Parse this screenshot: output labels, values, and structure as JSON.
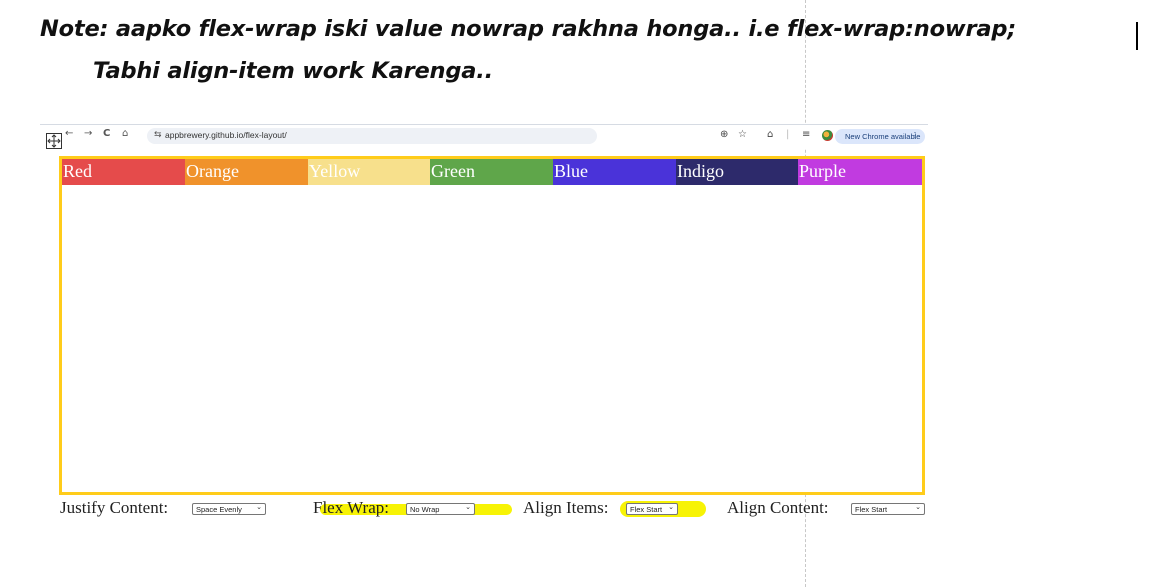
{
  "annotation": {
    "line1": "Note: aapko flex-wrap iski value nowrap rakhna honga..   i.e flex-wrap:nowrap;",
    "line2": "Tabhi align-item work Karenga.."
  },
  "browser": {
    "url": "appbrewery.github.io/flex-layout/",
    "update_pill": "New Chrome available",
    "nav": {
      "back": "←",
      "forward": "→",
      "reload": "C",
      "home": "⌂"
    },
    "toolbar_icons": {
      "zoom": "⊕",
      "star": "☆",
      "extensions": "⌂",
      "reading_list": "≡"
    }
  },
  "flex_items": [
    {
      "label": "Red",
      "color": "#e54b4b"
    },
    {
      "label": "Orange",
      "color": "#f0922b"
    },
    {
      "label": "Yellow",
      "color": "#f7e08c"
    },
    {
      "label": "Green",
      "color": "#5fa64a"
    },
    {
      "label": "Blue",
      "color": "#4a33d9"
    },
    {
      "label": "Indigo",
      "color": "#2d2a6b"
    },
    {
      "label": "Purple",
      "color": "#c13be0"
    }
  ],
  "controls": {
    "justify": {
      "label": "Justify Content:",
      "value": "Space Evenly"
    },
    "wrap": {
      "label": "Flex Wrap:",
      "value": "No Wrap"
    },
    "align_items": {
      "label": "Align Items:",
      "value": "Flex Start"
    },
    "align_content": {
      "label": "Align Content:",
      "value": "Flex Start"
    }
  },
  "colors": {
    "container_border": "#ffcc1a",
    "highlight": "#f7f305"
  }
}
